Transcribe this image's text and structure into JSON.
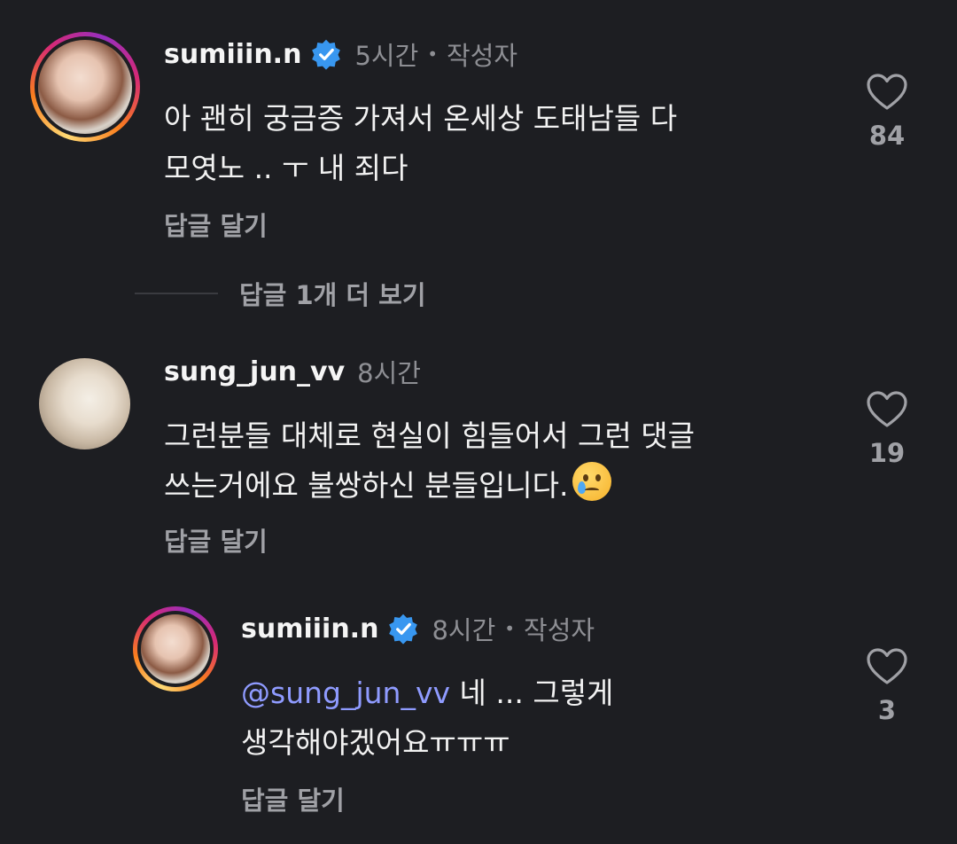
{
  "comments": [
    {
      "username": "sumiiin.n",
      "verified": true,
      "time": "5시간",
      "author_badge": "작성자",
      "text_line1": "아 괜히 궁금증 가져서 온세상 도태남들 다",
      "text_line2": "모엿노 .. ㅜ 내 죄다",
      "reply_label": "답글 달기",
      "likes": "84"
    },
    {
      "username": "sung_jun_vv",
      "verified": false,
      "time": "8시간",
      "text_line1": "그런분들 대체로 현실이 힘들어서 그런 댓글",
      "text_line2": "쓰는거에요 불쌍하신 분들입니다.",
      "emoji": "crying-face",
      "reply_label": "답글 달기",
      "likes": "19"
    },
    {
      "username": "sumiiin.n",
      "verified": true,
      "time": "8시간",
      "author_badge": "작성자",
      "mention": "@sung_jun_vv",
      "text_line1": " 네 ... 그렇게",
      "text_line2": "생각해야겠어요ㅠㅠㅠ",
      "reply_label": "답글 달기",
      "likes": "3"
    }
  ],
  "more_replies": "답글 1개 더 보기",
  "colors": {
    "background": "#1d1e22",
    "verified": "#3897f0",
    "mention": "#8f9bff",
    "muted": "#8e8f94"
  }
}
